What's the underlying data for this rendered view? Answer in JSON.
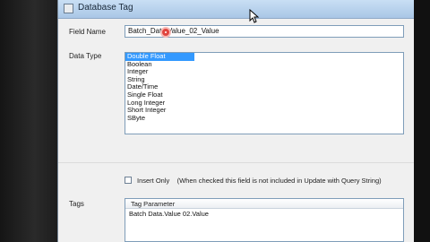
{
  "window": {
    "title": "Database Tag"
  },
  "form": {
    "field_name_label": "Field Name",
    "field_name_value": "Batch_Data.Value_02_Value",
    "data_type_label": "Data Type",
    "data_types": [
      "Double Float",
      "Boolean",
      "Integer",
      "String",
      "Date/Time",
      "Single Float",
      "Long Integer",
      "Short Integer",
      "SByte"
    ],
    "selected_data_type": "Double Float",
    "insert_only_label": "Insert Only",
    "insert_only_note": "(When checked this field is not included in Update with Query String)",
    "insert_only_checked": false,
    "tags_label": "Tags",
    "tags_column_header": "Tag Parameter",
    "tags_rows": [
      "Batch Data.Value 02.Value"
    ]
  },
  "colors": {
    "selection": "#3399ff",
    "titlebar": "#b9d3ee",
    "cursor_highlight": "#e0453f"
  }
}
